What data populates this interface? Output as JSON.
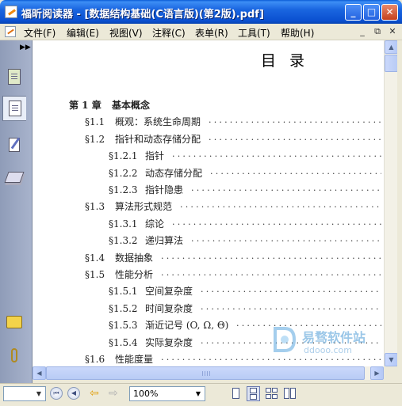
{
  "window": {
    "title": "福昕阅读器 - [数据结构基础(C语言版)(第2版).pdf]",
    "controls": {
      "minimize": "_",
      "maximize": "□",
      "close": "✕"
    }
  },
  "menu": {
    "items": [
      "文件(F)",
      "编辑(E)",
      "视图(V)",
      "注释(C)",
      "表单(R)",
      "工具(T)",
      "帮助(H)"
    ],
    "mdi": [
      "_",
      "⧉",
      "✕"
    ]
  },
  "left_panel": {
    "tabs": [
      "pages-icon",
      "thumbnails-icon",
      "annotations-icon",
      "layers-icon",
      "comments-icon",
      "attachments-icon"
    ],
    "active_tab": 1
  },
  "document": {
    "toc_title": "目录",
    "entries": [
      {
        "num": "第 1 章",
        "label": "基本概念",
        "level": 0
      },
      {
        "num": "§1.1",
        "label": "概观：系统生命周期",
        "level": 1
      },
      {
        "num": "§1.2",
        "label": "指针和动态存储分配",
        "level": 1
      },
      {
        "num": "§1.2.1",
        "label": "指针",
        "level": 2
      },
      {
        "num": "§1.2.2",
        "label": "动态存储分配",
        "level": 2
      },
      {
        "num": "§1.2.3",
        "label": "指针隐患",
        "level": 2
      },
      {
        "num": "§1.3",
        "label": "算法形式规范",
        "level": 1
      },
      {
        "num": "§1.3.1",
        "label": "综论",
        "level": 2
      },
      {
        "num": "§1.3.2",
        "label": "递归算法",
        "level": 2
      },
      {
        "num": "§1.4",
        "label": "数据抽象",
        "level": 1
      },
      {
        "num": "§1.5",
        "label": "性能分析",
        "level": 1
      },
      {
        "num": "§1.5.1",
        "label": "空间复杂度",
        "level": 2
      },
      {
        "num": "§1.5.2",
        "label": "时间复杂度",
        "level": 2
      },
      {
        "num": "§1.5.3",
        "label": "渐近记号 (O, Ω, Θ)",
        "level": 2
      },
      {
        "num": "§1.5.4",
        "label": "实际复杂度",
        "level": 2
      },
      {
        "num": "§1.6",
        "label": "性能度量",
        "level": 1
      }
    ],
    "watermark": {
      "name": "易骛软件站",
      "url": "ddooo.com"
    }
  },
  "statusbar": {
    "page_value": "",
    "zoom": "100%",
    "nav": {
      "first": "⏮",
      "prev": "◀",
      "back": "⇦",
      "forward": "⇨"
    },
    "view_modes": [
      "single-page",
      "continuous",
      "facing",
      "continuous-facing"
    ],
    "active_view": 1
  }
}
